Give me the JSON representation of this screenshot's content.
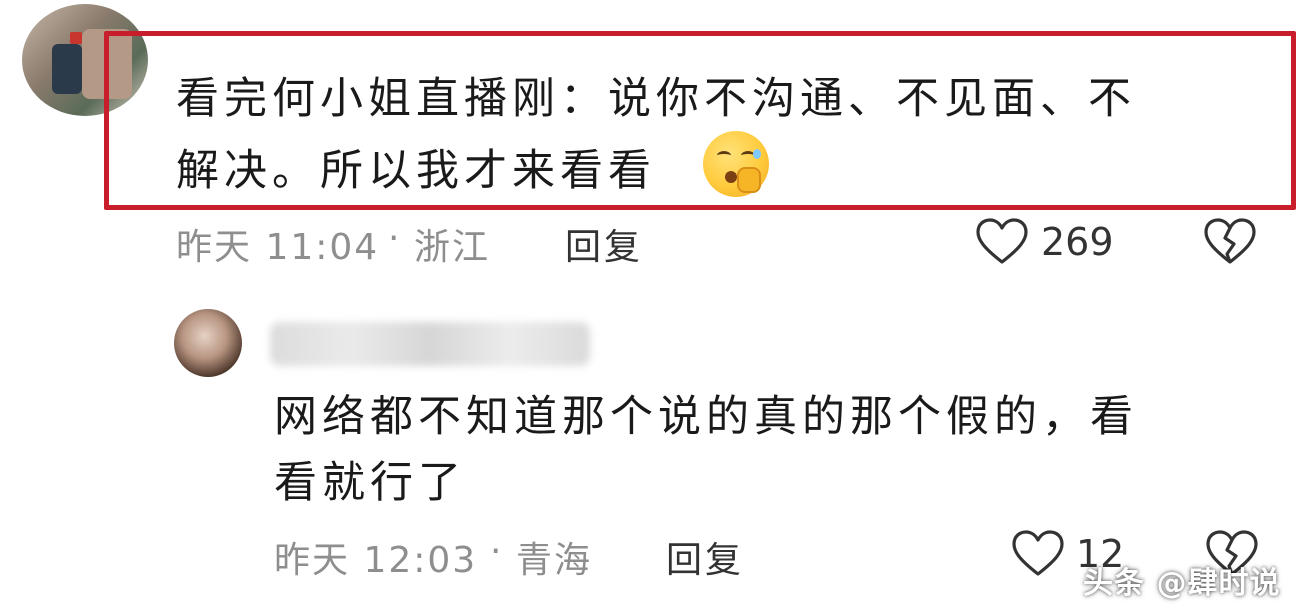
{
  "comments": [
    {
      "lines": [
        "看完何小姐直播刚：说你不沟通、不见面、不",
        "解决。所以我才来看看"
      ],
      "emoji": "shushing-face-emoji",
      "time": "昨天 11:04",
      "location": "浙江",
      "reply_label": "回复",
      "like_count": "269",
      "highlighted": true,
      "highlight_color": "#c81e2b"
    },
    {
      "lines": [
        "网络都不知道那个说的真的那个假的，看",
        "看就行了"
      ],
      "time": "昨天 12:03",
      "location": "青海",
      "reply_label": "回复",
      "like_count": "12"
    }
  ],
  "watermark": "头条 @肆时说",
  "icons": {
    "like": "heart-outline-icon",
    "dislike": "broken-heart-icon"
  },
  "colors": {
    "text": "#1a1a1a",
    "meta": "#8e8e8e",
    "highlight": "#c81e2b"
  }
}
